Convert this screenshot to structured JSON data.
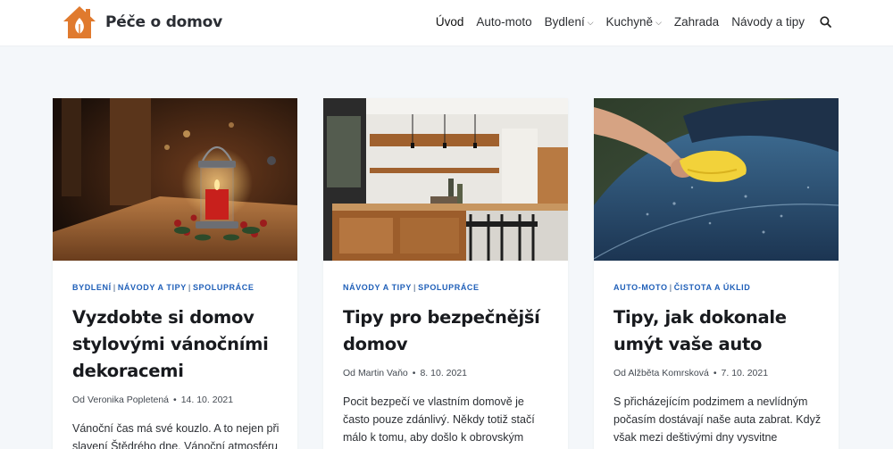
{
  "site": {
    "name": "Péče o domov",
    "brand_color": "#e07a2e"
  },
  "nav": {
    "items": [
      {
        "label": "Úvod",
        "has_dropdown": false
      },
      {
        "label": "Auto-moto",
        "has_dropdown": false
      },
      {
        "label": "Bydlení",
        "has_dropdown": true
      },
      {
        "label": "Kuchyně",
        "has_dropdown": true
      },
      {
        "label": "Zahrada",
        "has_dropdown": false
      },
      {
        "label": "Návody a tipy",
        "has_dropdown": false
      }
    ],
    "search_icon": "search-icon",
    "dropdown_icon": "chevron-down-icon"
  },
  "posts": [
    {
      "categories": [
        "Bydlení",
        "Návody a tipy",
        "Spolupráce"
      ],
      "title": "Vyzdobte si domov stylovými vánočními dekoracemi",
      "author_prefix": "Od",
      "author": "Veronika Popletená",
      "date": "14. 10. 2021",
      "excerpt": "Vánoční čas má své kouzlo. A to nejen při slavení Štědrého dne. Vánoční atmosféru"
    },
    {
      "categories": [
        "Návody a tipy",
        "Spolupráce"
      ],
      "title": "Tipy pro bezpečnější domov",
      "author_prefix": "Od",
      "author": "Martin Vaňo",
      "date": "8. 10. 2021",
      "excerpt": "Pocit bezpečí ve vlastním domově je často pouze zdánlivý. Někdy totiž stačí málo k tomu, aby došlo k obrovským majetkovým škodám, poškození zdraví,"
    },
    {
      "categories": [
        "Auto-moto",
        "Čistota a úklid"
      ],
      "title": "Tipy, jak dokonale umýt vaše auto",
      "author_prefix": "Od",
      "author": "Alžběta Komrsková",
      "date": "7. 10. 2021",
      "excerpt": "S přicházejícím podzimem a nevlídným počasím dostávají naše auta zabrat. Když však mezi deštivými dny vysvitne podzimní slunce, využijte té příležitosti pro"
    }
  ]
}
